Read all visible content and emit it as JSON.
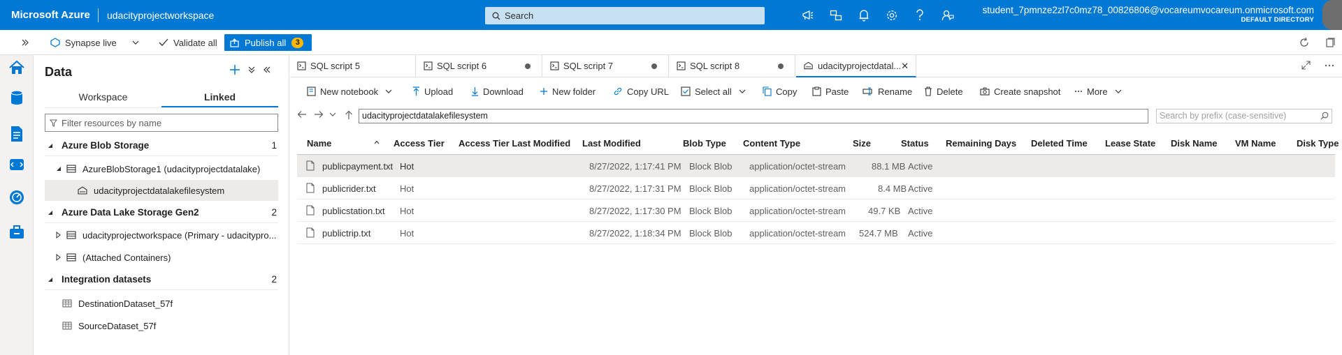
{
  "topbar": {
    "brand": "Microsoft Azure",
    "workspace": "udacityprojectworkspace",
    "search_placeholder": "Search",
    "account_email": "student_7pmnze2zl7c0mz78_00826806@vocareumvocareum.onmicrosoft.com",
    "account_directory": "DEFAULT DIRECTORY"
  },
  "toolbar": {
    "synapse_live": "Synapse live",
    "validate_all": "Validate all",
    "publish_all": "Publish all",
    "publish_count": "3"
  },
  "data_panel": {
    "title": "Data",
    "tabs": [
      "Workspace",
      "Linked"
    ],
    "active_tab": "Linked",
    "filter_placeholder": "Filter resources by name",
    "sections": {
      "blob": {
        "label": "Azure Blob Storage",
        "count": "1"
      },
      "blob_account": "AzureBlobStorage1 (udacityprojectdatalake)",
      "blob_container": "udacityprojectdatalakefilesystem",
      "adls": {
        "label": "Azure Data Lake Storage Gen2",
        "count": "2"
      },
      "adls_workspace": "udacityprojectworkspace (Primary - udacitypro...",
      "adls_attached": "(Attached Containers)",
      "integration": {
        "label": "Integration datasets",
        "count": "2"
      },
      "dataset_1": "DestinationDataset_57f",
      "dataset_2": "SourceDataset_57f"
    }
  },
  "editor_tabs": [
    {
      "label": "SQL script 5"
    },
    {
      "label": "SQL script 6"
    },
    {
      "label": "SQL script 7"
    },
    {
      "label": "SQL script 8"
    },
    {
      "label": "udacityprojectdatal..."
    }
  ],
  "editor_toolbar": {
    "new_notebook": "New notebook",
    "upload": "Upload",
    "download": "Download",
    "new_folder": "New folder",
    "copy_url": "Copy URL",
    "select_all": "Select all",
    "copy": "Copy",
    "paste": "Paste",
    "rename": "Rename",
    "delete": "Delete",
    "create_snapshot": "Create snapshot",
    "more": "More"
  },
  "path": {
    "value": "udacityprojectdatalakefilesystem",
    "prefix_placeholder": "Search by prefix (case-sensitive)"
  },
  "table": {
    "columns": [
      "Name",
      "Access Tier",
      "Access Tier Last Modified",
      "Last Modified",
      "Blob Type",
      "Content Type",
      "Size",
      "Status",
      "Remaining Days",
      "Deleted Time",
      "Lease State",
      "Disk Name",
      "VM Name",
      "Disk Type"
    ],
    "rows": [
      {
        "name": "publicpayment.txt",
        "tier": "Hot",
        "modified": "8/27/2022, 1:17:41 PM",
        "blob_type": "Block Blob",
        "content_type": "application/octet-stream",
        "size": "88.1 MB",
        "status": "Active"
      },
      {
        "name": "publicrider.txt",
        "tier": "Hot",
        "modified": "8/27/2022, 1:17:31 PM",
        "blob_type": "Block Blob",
        "content_type": "application/octet-stream",
        "size": "8.4 MB",
        "status": "Active"
      },
      {
        "name": "publicstation.txt",
        "tier": "Hot",
        "modified": "8/27/2022, 1:17:30 PM",
        "blob_type": "Block Blob",
        "content_type": "application/octet-stream",
        "size": "49.7 KB",
        "status": "Active"
      },
      {
        "name": "publictrip.txt",
        "tier": "Hot",
        "modified": "8/27/2022, 1:18:34 PM",
        "blob_type": "Block Blob",
        "content_type": "application/octet-stream",
        "size": "524.7 MB",
        "status": "Active"
      }
    ]
  }
}
